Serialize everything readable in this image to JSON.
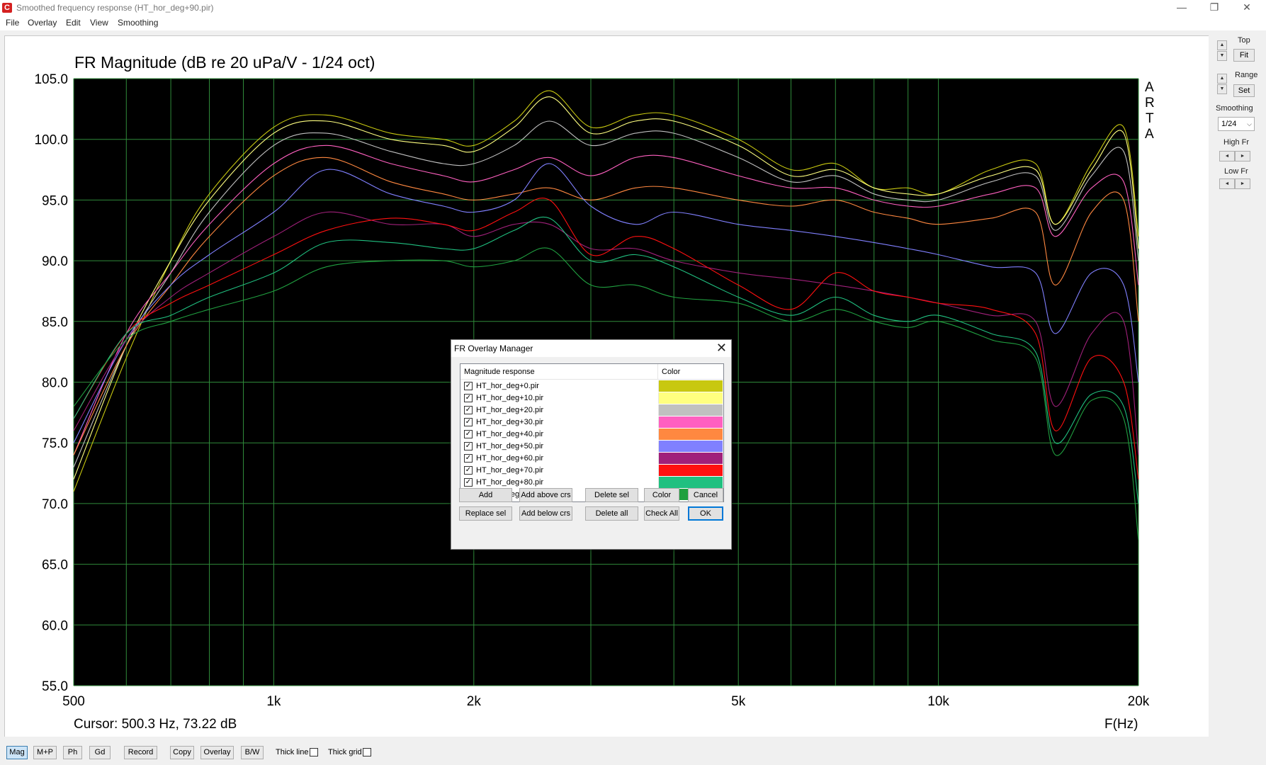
{
  "window": {
    "title": "Smoothed frequency response (HT_hor_deg+90.pir)",
    "app_icon_glyph": "C",
    "controls": {
      "minimize": "—",
      "maximize": "❐",
      "close": "✕"
    }
  },
  "menu": [
    "File",
    "Overlay",
    "Edit",
    "View",
    "Smoothing"
  ],
  "plot": {
    "cursor_text": "Cursor: 500.3 Hz, 73.22 dB",
    "xunit_label": "F(Hz)",
    "brand_letters": [
      "A",
      "R",
      "T",
      "A"
    ]
  },
  "chart_data": {
    "type": "line",
    "title": "FR Magnitude (dB re 20 uPa/V - 1/24 oct)",
    "xlabel": "F(Hz)",
    "ylabel": "",
    "xscale": "log",
    "xlim": [
      500,
      20000
    ],
    "ylim": [
      55,
      105
    ],
    "xticks": [
      500,
      1000,
      2000,
      5000,
      10000,
      20000
    ],
    "xtick_labels": [
      "500",
      "1k",
      "2k",
      "5k",
      "10k",
      "20k"
    ],
    "yticks": [
      105,
      100,
      95,
      90,
      85,
      80,
      75,
      70,
      65,
      60,
      55
    ],
    "ytick_labels": [
      "105.0",
      "100.0",
      "95.0",
      "90.0",
      "85.0",
      "80.0",
      "75.0",
      "70.0",
      "65.0",
      "60.0",
      "55.0"
    ],
    "grid": true,
    "background": "#000000",
    "grid_color": "#2f8a3a",
    "x": [
      500,
      600,
      700,
      800,
      1000,
      1200,
      1500,
      1800,
      2000,
      2300,
      2600,
      3000,
      3500,
      4000,
      5000,
      6000,
      7000,
      8000,
      9000,
      10000,
      12000,
      14000,
      15000,
      17000,
      19000,
      20000
    ],
    "series": [
      {
        "name": "HT_hor_deg+0.pir",
        "color": "#c8c810",
        "values": [
          71,
          82,
          90,
          95.5,
          101,
          102,
          100.5,
          100,
          99.5,
          101.5,
          104,
          101,
          102,
          102,
          100,
          97.5,
          98,
          96,
          96,
          95.5,
          97.5,
          98,
          93,
          98,
          101,
          92
        ]
      },
      {
        "name": "HT_hor_deg+10.pir",
        "color": "#ffff80",
        "values": [
          72,
          83,
          90,
          95,
          100.5,
          101.5,
          100,
          99.5,
          99,
          101,
          103.5,
          100.5,
          101.5,
          101.5,
          99.5,
          97,
          97.5,
          96,
          95.5,
          95.5,
          97,
          97.5,
          93,
          97.5,
          100.5,
          91
        ]
      },
      {
        "name": "HT_hor_deg+20.pir",
        "color": "#c0c0c0",
        "values": [
          73,
          83,
          89,
          94,
          99.5,
          100.5,
          99,
          98,
          98,
          99.5,
          101.5,
          99.5,
          100.5,
          100.5,
          98.5,
          96.5,
          97,
          95.5,
          95,
          95,
          96.5,
          97,
          92.5,
          97,
          99,
          90
        ]
      },
      {
        "name": "HT_hor_deg+30.pir",
        "color": "#ff60c0",
        "values": [
          74,
          84,
          89,
          93,
          98,
          99.5,
          98,
          97,
          96.5,
          97.5,
          98.5,
          97,
          98.5,
          98.5,
          97,
          96,
          96,
          95,
          94.5,
          94.5,
          95.5,
          96,
          92,
          96,
          96.5,
          88
        ]
      },
      {
        "name": "HT_hor_deg+40.pir",
        "color": "#ff8840",
        "values": [
          74,
          83,
          88,
          92,
          97,
          98.5,
          96.5,
          95.5,
          95,
          95.5,
          96,
          95,
          96,
          96,
          95,
          94.5,
          95,
          94,
          93.5,
          93,
          93.5,
          94,
          88,
          94,
          95,
          85
        ]
      },
      {
        "name": "HT_hor_deg+50.pir",
        "color": "#8080ff",
        "values": [
          75,
          83.5,
          88,
          90.5,
          94,
          97.5,
          95.5,
          94.5,
          94,
          95,
          98,
          94.5,
          93,
          94,
          93,
          92.5,
          92,
          91.5,
          91,
          90.5,
          89.5,
          89,
          84,
          89,
          88,
          80
        ]
      },
      {
        "name": "HT_hor_deg+60.pir",
        "color": "#a0207a",
        "values": [
          76,
          83.5,
          87,
          89,
          92,
          94,
          93,
          93,
          92,
          93,
          93,
          91,
          91,
          90,
          89,
          88.5,
          88,
          87.5,
          87,
          86.5,
          85.5,
          85,
          78,
          84,
          85,
          74
        ]
      },
      {
        "name": "HT_hor_deg+70.pir",
        "color": "#ff1010",
        "values": [
          77,
          84,
          86.5,
          88,
          90.5,
          92.5,
          93.5,
          93,
          92.5,
          94,
          95,
          90.5,
          92,
          91,
          88,
          86,
          89,
          87.5,
          87,
          86.5,
          86,
          84,
          76,
          82,
          80,
          72
        ]
      },
      {
        "name": "HT_hor_deg+80.pir",
        "color": "#20c080",
        "values": [
          77,
          84,
          85.5,
          87,
          89,
          91.5,
          91.5,
          91,
          91,
          92.5,
          93.5,
          90,
          90.5,
          89.5,
          87,
          85.5,
          87,
          85.5,
          85,
          85.5,
          84,
          82.5,
          75,
          79,
          78,
          70
        ]
      },
      {
        "name": "HT_hor_deg+90.pir",
        "color": "#20a040",
        "values": [
          78,
          83.5,
          85,
          86,
          87.5,
          89.5,
          90,
          90,
          89.5,
          90,
          91,
          88,
          88,
          87,
          86.5,
          85,
          86,
          85,
          84.5,
          85,
          83.5,
          82,
          74,
          78.5,
          77,
          67
        ]
      }
    ]
  },
  "right_panel": {
    "top_label": "Top",
    "fit_label": "Fit",
    "range_label": "Range",
    "set_label": "Set",
    "smoothing_label": "Smoothing",
    "smoothing_value": "1/24",
    "high_fr_label": "High Fr",
    "low_fr_label": "Low Fr",
    "spin_up": "▲",
    "spin_down": "▼",
    "arrow_left": "◄",
    "arrow_right": "►",
    "caret": "⌵"
  },
  "bottom_toolbar": {
    "buttons": [
      "Mag",
      "M+P",
      "Ph",
      "Gd",
      "Record",
      "Copy",
      "Overlay",
      "B/W"
    ],
    "thick_line_label": "Thick line",
    "thick_grid_label": "Thick grid"
  },
  "dialog": {
    "title": "FR Overlay Manager",
    "close_glyph": "✕",
    "col_response": "Magnitude response",
    "col_color": "Color",
    "check_glyph": "✓",
    "rows": [
      {
        "name": "HT_hor_deg+0.pir",
        "color": "#c8c810"
      },
      {
        "name": "HT_hor_deg+10.pir",
        "color": "#ffff80"
      },
      {
        "name": "HT_hor_deg+20.pir",
        "color": "#c0c0c0"
      },
      {
        "name": "HT_hor_deg+30.pir",
        "color": "#ff60c0"
      },
      {
        "name": "HT_hor_deg+40.pir",
        "color": "#ff8840"
      },
      {
        "name": "HT_hor_deg+50.pir",
        "color": "#8080ff"
      },
      {
        "name": "HT_hor_deg+60.pir",
        "color": "#a0207a"
      },
      {
        "name": "HT_hor_deg+70.pir",
        "color": "#ff1010"
      },
      {
        "name": "HT_hor_deg+80.pir",
        "color": "#20c080"
      },
      {
        "name": "HT_hor_deg+90.pir",
        "color": "#20a040"
      }
    ],
    "buttons": {
      "add": "Add",
      "add_above": "Add above crs",
      "delete_sel": "Delete sel",
      "color": "Color",
      "cancel": "Cancel",
      "replace_sel": "Replace sel",
      "add_below": "Add below crs",
      "delete_all": "Delete all",
      "check_all": "Check All",
      "ok": "OK"
    }
  }
}
